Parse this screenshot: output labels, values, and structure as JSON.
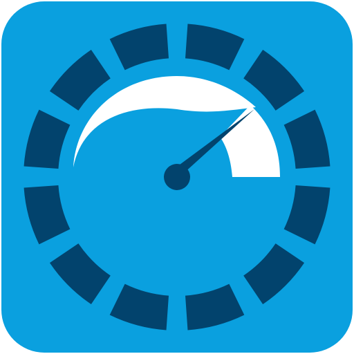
{
  "icon": {
    "name": "speedometer-icon",
    "colors": {
      "background": "#0aa0df",
      "ring": "#02436d",
      "highlight": "#ffffff",
      "needle": "#02436d"
    },
    "ring_segment_count": 12
  }
}
